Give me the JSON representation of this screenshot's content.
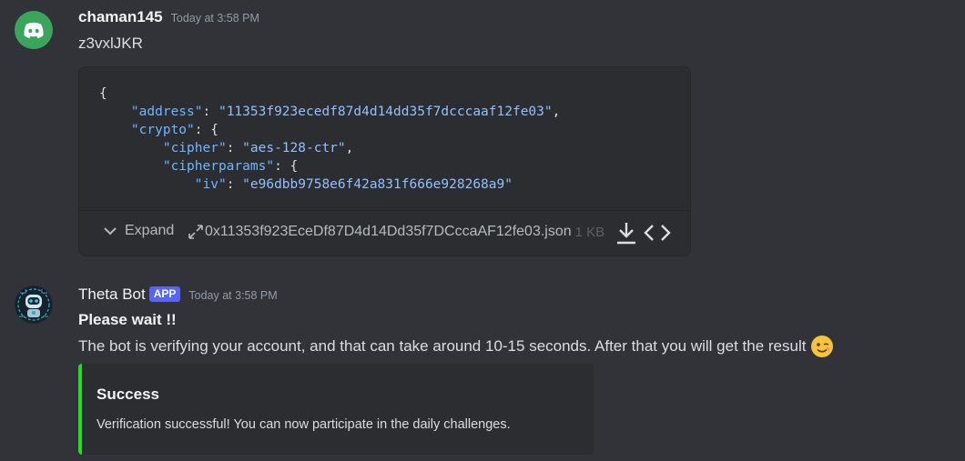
{
  "messages": [
    {
      "author": "chaman145",
      "timestamp": "Today at 3:58 PM",
      "text": "z3vxlJKR",
      "avatar_icon": "discord-logo-icon",
      "attachment": {
        "code_lines": [
          "{",
          "    \"address\": \"11353f923ecedf87d4d14dd35f7dcccaaf12fe03\",",
          "    \"crypto\": {",
          "        \"cipher\": \"aes-128-ctr\",",
          "        \"cipherparams\": {",
          "            \"iv\": \"e96dbb9758e6f42a831f666e928268a9\""
        ],
        "expand_label": "Expand",
        "filename": "0x11353f923EceDf87D4d14Dd35f7DCccaAF12fe03.json",
        "size": "1 KB"
      }
    },
    {
      "author": "Theta Bot",
      "badge": "APP",
      "timestamp": "Today at 3:58 PM",
      "title_text": "Please wait !!",
      "text": "The bot is verifying your account, and that can take around 10-15 seconds. After that you will get the result",
      "emoji": "winking-face-emoji",
      "avatar_icon": "robot-avatar-icon",
      "embed": {
        "title": "Success",
        "description": "Verification successful! You can now participate in the daily challenges.",
        "accent_color": "#23dd23"
      }
    }
  ],
  "colors": {
    "background": "#313338",
    "discord_green": "#3ba55d",
    "badge": "#5865f2",
    "json_key": "#6fb6ff"
  }
}
